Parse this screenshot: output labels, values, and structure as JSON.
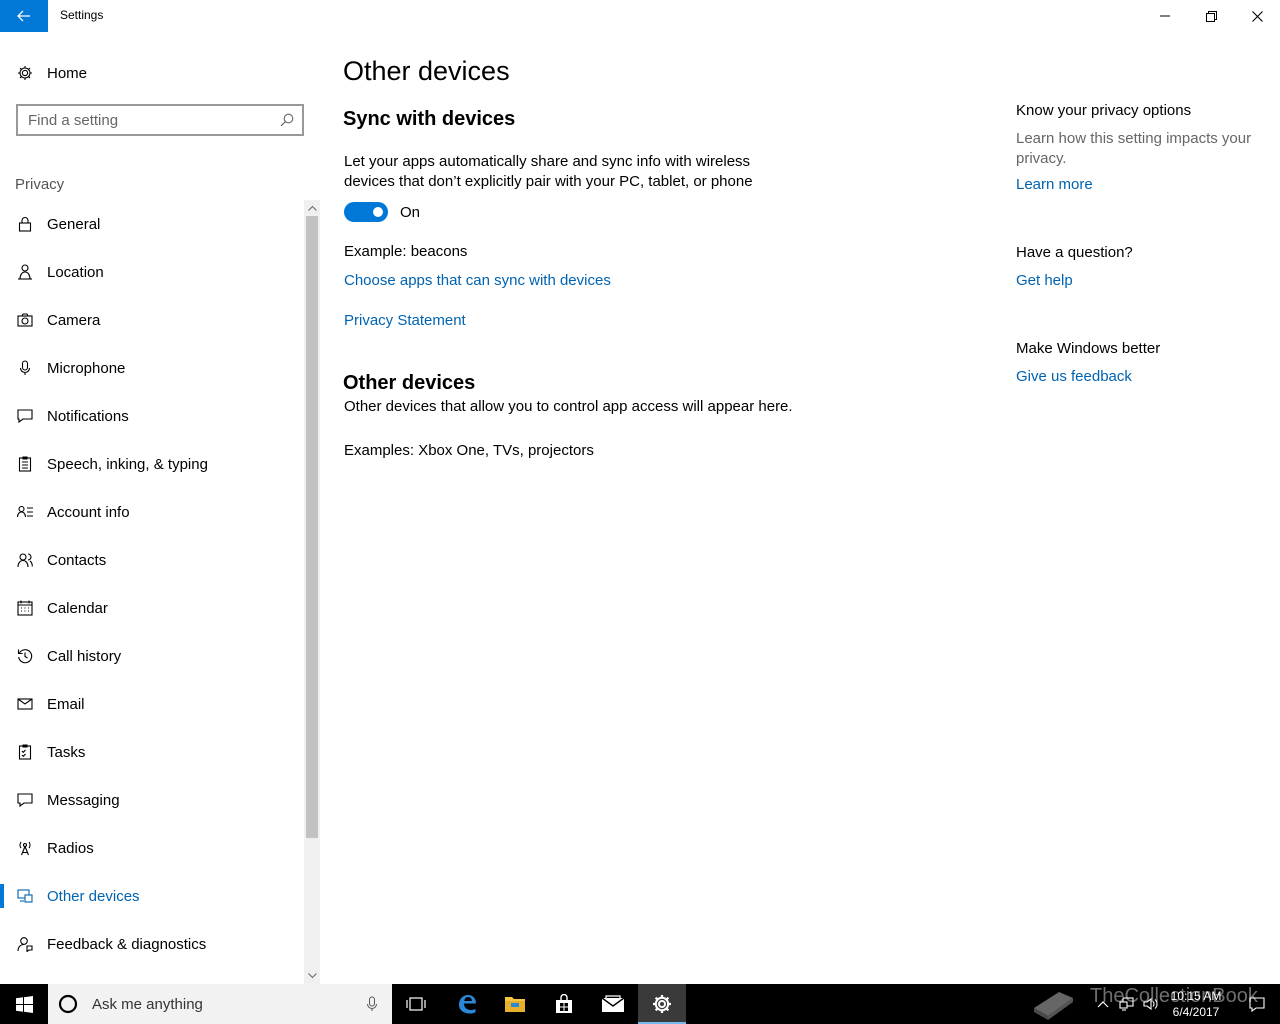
{
  "titlebar": {
    "title": "Settings"
  },
  "sidebar": {
    "home_label": "Home",
    "search_placeholder": "Find a setting",
    "section": "Privacy",
    "items": [
      {
        "label": "General",
        "icon": "lock-icon"
      },
      {
        "label": "Location",
        "icon": "location-person-icon"
      },
      {
        "label": "Camera",
        "icon": "camera-icon"
      },
      {
        "label": "Microphone",
        "icon": "microphone-icon"
      },
      {
        "label": "Notifications",
        "icon": "notification-icon"
      },
      {
        "label": "Speech, inking, & typing",
        "icon": "speech-clipboard-icon"
      },
      {
        "label": "Account info",
        "icon": "account-info-icon"
      },
      {
        "label": "Contacts",
        "icon": "contacts-icon"
      },
      {
        "label": "Calendar",
        "icon": "calendar-icon"
      },
      {
        "label": "Call history",
        "icon": "history-icon"
      },
      {
        "label": "Email",
        "icon": "email-icon"
      },
      {
        "label": "Tasks",
        "icon": "tasks-icon"
      },
      {
        "label": "Messaging",
        "icon": "messaging-icon"
      },
      {
        "label": "Radios",
        "icon": "radio-tower-icon"
      },
      {
        "label": "Other devices",
        "icon": "other-devices-icon",
        "active": true
      },
      {
        "label": "Feedback & diagnostics",
        "icon": "feedback-icon"
      }
    ]
  },
  "main": {
    "title": "Other devices",
    "sync": {
      "heading": "Sync with devices",
      "description_line1": "Let your apps automatically share and sync info with wireless",
      "description_line2": "devices that don’t explicitly pair with your PC, tablet, or phone",
      "toggle_state": "On",
      "example": "Example: beacons",
      "choose_apps_link": "Choose apps that can sync with devices",
      "privacy_link": "Privacy Statement"
    },
    "other": {
      "heading": "Other devices",
      "description": "Other devices that allow you to control app access will appear here.",
      "examples": "Examples: Xbox One, TVs, projectors"
    }
  },
  "right_pane": {
    "privacy_heading": "Know your privacy options",
    "privacy_text": "Learn how this setting impacts your privacy.",
    "learn_more": "Learn more",
    "question_heading": "Have a question?",
    "get_help": "Get help",
    "better_heading": "Make Windows better",
    "feedback_link": "Give us feedback"
  },
  "taskbar": {
    "search_placeholder": "Ask me anything",
    "time": "10:15 AM",
    "date": "6/4/2017",
    "watermark": "TheCollectionBook"
  },
  "colors": {
    "accent": "#0078d7",
    "link": "#0063b1",
    "taskbar": "#000000"
  }
}
